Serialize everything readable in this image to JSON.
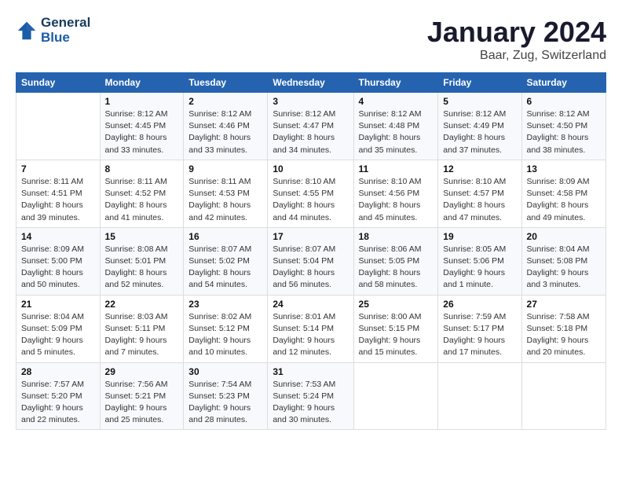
{
  "logo": {
    "line1": "General",
    "line2": "Blue"
  },
  "title": "January 2024",
  "subtitle": "Baar, Zug, Switzerland",
  "days_of_week": [
    "Sunday",
    "Monday",
    "Tuesday",
    "Wednesday",
    "Thursday",
    "Friday",
    "Saturday"
  ],
  "weeks": [
    [
      {
        "day": "",
        "sunrise": "",
        "sunset": "",
        "daylight": ""
      },
      {
        "day": "1",
        "sunrise": "Sunrise: 8:12 AM",
        "sunset": "Sunset: 4:45 PM",
        "daylight": "Daylight: 8 hours and 33 minutes."
      },
      {
        "day": "2",
        "sunrise": "Sunrise: 8:12 AM",
        "sunset": "Sunset: 4:46 PM",
        "daylight": "Daylight: 8 hours and 33 minutes."
      },
      {
        "day": "3",
        "sunrise": "Sunrise: 8:12 AM",
        "sunset": "Sunset: 4:47 PM",
        "daylight": "Daylight: 8 hours and 34 minutes."
      },
      {
        "day": "4",
        "sunrise": "Sunrise: 8:12 AM",
        "sunset": "Sunset: 4:48 PM",
        "daylight": "Daylight: 8 hours and 35 minutes."
      },
      {
        "day": "5",
        "sunrise": "Sunrise: 8:12 AM",
        "sunset": "Sunset: 4:49 PM",
        "daylight": "Daylight: 8 hours and 37 minutes."
      },
      {
        "day": "6",
        "sunrise": "Sunrise: 8:12 AM",
        "sunset": "Sunset: 4:50 PM",
        "daylight": "Daylight: 8 hours and 38 minutes."
      }
    ],
    [
      {
        "day": "7",
        "sunrise": "Sunrise: 8:11 AM",
        "sunset": "Sunset: 4:51 PM",
        "daylight": "Daylight: 8 hours and 39 minutes."
      },
      {
        "day": "8",
        "sunrise": "Sunrise: 8:11 AM",
        "sunset": "Sunset: 4:52 PM",
        "daylight": "Daylight: 8 hours and 41 minutes."
      },
      {
        "day": "9",
        "sunrise": "Sunrise: 8:11 AM",
        "sunset": "Sunset: 4:53 PM",
        "daylight": "Daylight: 8 hours and 42 minutes."
      },
      {
        "day": "10",
        "sunrise": "Sunrise: 8:10 AM",
        "sunset": "Sunset: 4:55 PM",
        "daylight": "Daylight: 8 hours and 44 minutes."
      },
      {
        "day": "11",
        "sunrise": "Sunrise: 8:10 AM",
        "sunset": "Sunset: 4:56 PM",
        "daylight": "Daylight: 8 hours and 45 minutes."
      },
      {
        "day": "12",
        "sunrise": "Sunrise: 8:10 AM",
        "sunset": "Sunset: 4:57 PM",
        "daylight": "Daylight: 8 hours and 47 minutes."
      },
      {
        "day": "13",
        "sunrise": "Sunrise: 8:09 AM",
        "sunset": "Sunset: 4:58 PM",
        "daylight": "Daylight: 8 hours and 49 minutes."
      }
    ],
    [
      {
        "day": "14",
        "sunrise": "Sunrise: 8:09 AM",
        "sunset": "Sunset: 5:00 PM",
        "daylight": "Daylight: 8 hours and 50 minutes."
      },
      {
        "day": "15",
        "sunrise": "Sunrise: 8:08 AM",
        "sunset": "Sunset: 5:01 PM",
        "daylight": "Daylight: 8 hours and 52 minutes."
      },
      {
        "day": "16",
        "sunrise": "Sunrise: 8:07 AM",
        "sunset": "Sunset: 5:02 PM",
        "daylight": "Daylight: 8 hours and 54 minutes."
      },
      {
        "day": "17",
        "sunrise": "Sunrise: 8:07 AM",
        "sunset": "Sunset: 5:04 PM",
        "daylight": "Daylight: 8 hours and 56 minutes."
      },
      {
        "day": "18",
        "sunrise": "Sunrise: 8:06 AM",
        "sunset": "Sunset: 5:05 PM",
        "daylight": "Daylight: 8 hours and 58 minutes."
      },
      {
        "day": "19",
        "sunrise": "Sunrise: 8:05 AM",
        "sunset": "Sunset: 5:06 PM",
        "daylight": "Daylight: 9 hours and 1 minute."
      },
      {
        "day": "20",
        "sunrise": "Sunrise: 8:04 AM",
        "sunset": "Sunset: 5:08 PM",
        "daylight": "Daylight: 9 hours and 3 minutes."
      }
    ],
    [
      {
        "day": "21",
        "sunrise": "Sunrise: 8:04 AM",
        "sunset": "Sunset: 5:09 PM",
        "daylight": "Daylight: 9 hours and 5 minutes."
      },
      {
        "day": "22",
        "sunrise": "Sunrise: 8:03 AM",
        "sunset": "Sunset: 5:11 PM",
        "daylight": "Daylight: 9 hours and 7 minutes."
      },
      {
        "day": "23",
        "sunrise": "Sunrise: 8:02 AM",
        "sunset": "Sunset: 5:12 PM",
        "daylight": "Daylight: 9 hours and 10 minutes."
      },
      {
        "day": "24",
        "sunrise": "Sunrise: 8:01 AM",
        "sunset": "Sunset: 5:14 PM",
        "daylight": "Daylight: 9 hours and 12 minutes."
      },
      {
        "day": "25",
        "sunrise": "Sunrise: 8:00 AM",
        "sunset": "Sunset: 5:15 PM",
        "daylight": "Daylight: 9 hours and 15 minutes."
      },
      {
        "day": "26",
        "sunrise": "Sunrise: 7:59 AM",
        "sunset": "Sunset: 5:17 PM",
        "daylight": "Daylight: 9 hours and 17 minutes."
      },
      {
        "day": "27",
        "sunrise": "Sunrise: 7:58 AM",
        "sunset": "Sunset: 5:18 PM",
        "daylight": "Daylight: 9 hours and 20 minutes."
      }
    ],
    [
      {
        "day": "28",
        "sunrise": "Sunrise: 7:57 AM",
        "sunset": "Sunset: 5:20 PM",
        "daylight": "Daylight: 9 hours and 22 minutes."
      },
      {
        "day": "29",
        "sunrise": "Sunrise: 7:56 AM",
        "sunset": "Sunset: 5:21 PM",
        "daylight": "Daylight: 9 hours and 25 minutes."
      },
      {
        "day": "30",
        "sunrise": "Sunrise: 7:54 AM",
        "sunset": "Sunset: 5:23 PM",
        "daylight": "Daylight: 9 hours and 28 minutes."
      },
      {
        "day": "31",
        "sunrise": "Sunrise: 7:53 AM",
        "sunset": "Sunset: 5:24 PM",
        "daylight": "Daylight: 9 hours and 30 minutes."
      },
      {
        "day": "",
        "sunrise": "",
        "sunset": "",
        "daylight": ""
      },
      {
        "day": "",
        "sunrise": "",
        "sunset": "",
        "daylight": ""
      },
      {
        "day": "",
        "sunrise": "",
        "sunset": "",
        "daylight": ""
      }
    ]
  ]
}
